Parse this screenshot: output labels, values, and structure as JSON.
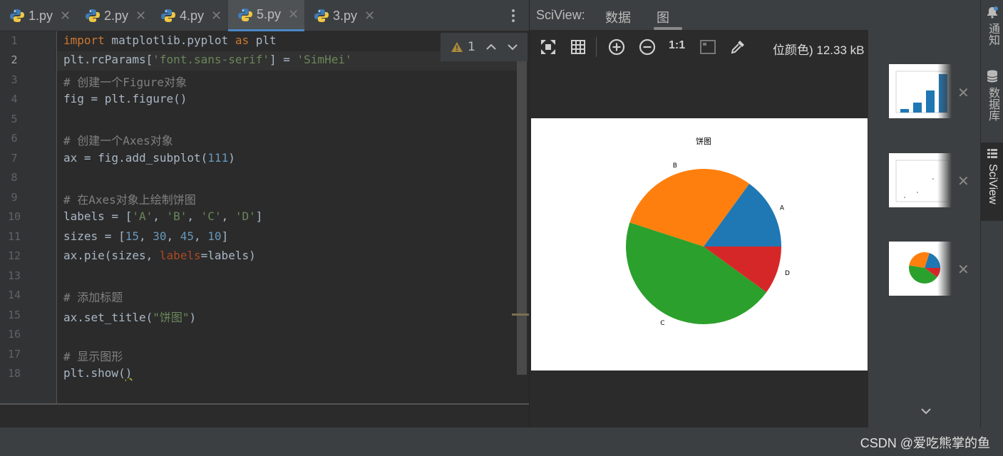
{
  "tabs": [
    {
      "label": "1.py",
      "active": false
    },
    {
      "label": "2.py",
      "active": false
    },
    {
      "label": "4.py",
      "active": false
    },
    {
      "label": "5.py",
      "active": true
    },
    {
      "label": "3.py",
      "active": false
    }
  ],
  "editor": {
    "line_numbers": [
      "1",
      "2",
      "3",
      "4",
      "5",
      "6",
      "7",
      "8",
      "9",
      "10",
      "11",
      "12",
      "13",
      "14",
      "15",
      "16",
      "17",
      "18"
    ],
    "current_line": "2",
    "inspection": {
      "warning_count": "1"
    },
    "code": {
      "l1_kw1": "import",
      "l1_mod": " matplotlib.pyplot ",
      "l1_kw2": "as",
      "l1_alias": " plt",
      "l2_a": "plt.rcParams[",
      "l2_s1": "'font.sans-serif'",
      "l2_b": "] = ",
      "l2_s2": "'SimHei'",
      "l3": "# 创建一个Figure对象",
      "l4": "fig = plt.figure()",
      "l6": "# 创建一个Axes对象",
      "l7_a": "ax = fig.add_subplot(",
      "l7_n": "111",
      "l7_b": ")",
      "l9": "# 在Axes对象上绘制饼图",
      "l10_a": "labels = [",
      "l10_s1": "'A'",
      "l10_s2": "'B'",
      "l10_s3": "'C'",
      "l10_s4": "'D'",
      "l10_comma": ", ",
      "l10_b": "]",
      "l11_a": "sizes = [",
      "l11_n1": "15",
      "l11_n2": "30",
      "l11_n3": "45",
      "l11_n4": "10",
      "l11_comma": ", ",
      "l11_b": "]",
      "l12_a": "ax.pie(sizes, ",
      "l12_p": "labels",
      "l12_b": "=labels)",
      "l14": "# 添加标题",
      "l15_a": "ax.set_title(",
      "l15_s": "\"饼图\"",
      "l15_b": ")",
      "l17": "# 显示图形",
      "l18_a": "plt.show(",
      "l18_b": ")"
    }
  },
  "sciview": {
    "title": "SciView:",
    "tabs": [
      "数据",
      "图"
    ],
    "active_tab": "图",
    "pixel_info": "位颜色) 12.33 kB",
    "toolbar_icons": [
      "fit-icon",
      "grid-icon",
      "zoom-in-icon",
      "zoom-out-icon",
      "actual-size-icon",
      "chessboard-icon",
      "color-picker-icon"
    ],
    "actual_size_label": "1:1"
  },
  "chart_data": {
    "type": "pie",
    "title": "饼图",
    "categories": [
      "A",
      "B",
      "C",
      "D"
    ],
    "values": [
      15,
      30,
      45,
      10
    ],
    "colors": [
      "#1f77b4",
      "#ff7f0e",
      "#2ca02c",
      "#d62728"
    ],
    "start_angle": 0,
    "direction": "counterclockwise"
  },
  "thumbnails": [
    {
      "kind": "bar-chart"
    },
    {
      "kind": "scatter-chart"
    },
    {
      "kind": "pie-chart"
    }
  ],
  "toolstrip": [
    {
      "label": "通知",
      "icon": "bell-icon"
    },
    {
      "label": "数据库",
      "icon": "database-icon"
    },
    {
      "label": "SciView",
      "icon": "sciview-icon"
    }
  ],
  "watermark": "CSDN @爱吃熊掌的鱼"
}
